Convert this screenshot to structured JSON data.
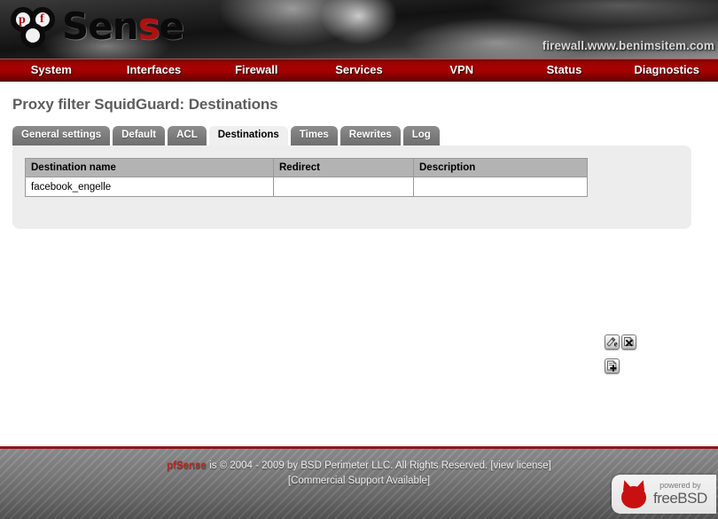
{
  "brand": {
    "logo_prefix_p": "p",
    "logo_prefix_f": "f",
    "logo_word_1": "Sen",
    "logo_word_red": "s",
    "logo_word_2": "e",
    "hostname": "firewall.www.benimsitem.com",
    "accent_red": "#b01010",
    "navbar_red": "#a80000"
  },
  "nav": {
    "items": [
      {
        "label": "System"
      },
      {
        "label": "Interfaces"
      },
      {
        "label": "Firewall"
      },
      {
        "label": "Services"
      },
      {
        "label": "VPN"
      },
      {
        "label": "Status"
      },
      {
        "label": "Diagnostics"
      }
    ]
  },
  "page": {
    "title": "Proxy filter SquidGuard: Destinations"
  },
  "tabs": [
    {
      "label": "General settings",
      "active": false
    },
    {
      "label": "Default",
      "active": false
    },
    {
      "label": "ACL",
      "active": false
    },
    {
      "label": "Destinations",
      "active": true
    },
    {
      "label": "Times",
      "active": false
    },
    {
      "label": "Rewrites",
      "active": false
    },
    {
      "label": "Log",
      "active": false
    }
  ],
  "table": {
    "columns": [
      "Destination name",
      "Redirect",
      "Description"
    ],
    "rows": [
      {
        "name": "facebook_engelle",
        "redirect": "",
        "description": ""
      }
    ]
  },
  "actions": {
    "edit_label": "e",
    "delete_label": "x",
    "add_label": "+"
  },
  "footer": {
    "brand": "pfSense",
    "line1": " is © 2004 - 2009 by BSD Perimeter LLC. All Rights Reserved. [view license]",
    "line2": "[Commercial Support Available]",
    "powered_by": "powered by",
    "os_name": "freeBSD"
  }
}
